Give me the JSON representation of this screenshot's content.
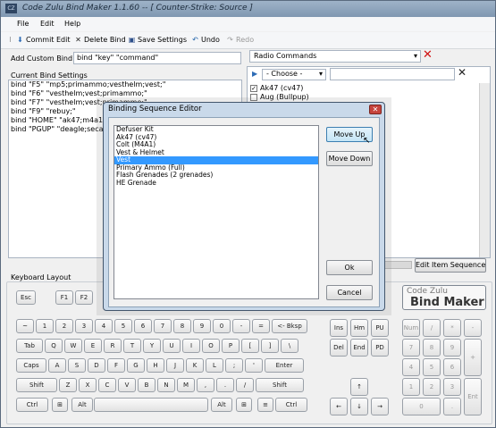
{
  "app": {
    "title": "Code Zulu Bind Maker 1.1.60 -- [ Counter-Strike: Source ]",
    "icon": "app-icon"
  },
  "menu": [
    "File",
    "Edit",
    "Help"
  ],
  "toolbar": {
    "commit": "Commit Edit",
    "delete": "Delete Bind",
    "save": "Save Settings",
    "undo": "Undo",
    "redo": "Redo"
  },
  "custom_bind": {
    "label": "Add Custom Bind:",
    "value": "bind \"key\" \"command\""
  },
  "current_binds": {
    "label": "Current Bind Settings",
    "lines": [
      "bind \"F5\" \"mp5;primammo;vesthelm;vest;\"",
      "bind \"F6\" \"vesthelm;vest;primammo;\"",
      "bind \"F7\" \"vesthelm;vest;primammo;\"",
      "bind \"F9\" \"rebuy;\"",
      "bind \"HOME\" \"ak47;m4a1;prim",
      "bind \"PGUP\" \"deagle;secamm"
    ]
  },
  "right_panel": {
    "commands_select": "Radio Commands",
    "choose_select": "- Choose -",
    "items": [
      {
        "label": "Ak47 (cv47)",
        "checked": true
      },
      {
        "label": "Aug (Bullpup)",
        "checked": false
      }
    ],
    "edit_sequence": "Edit Item Sequence"
  },
  "dialog": {
    "title": "Binding Sequence Editor",
    "items": [
      "Defuser Kit",
      "Ak47 (cv47)",
      "Colt (M4A1)",
      "Vest & Helmet",
      "Vest",
      "Primary Ammo (Full)",
      "Flash Grenades (2 grenades)",
      "HE Grenade"
    ],
    "selected_index": 4,
    "move_up": "Move Up",
    "move_down": "Move Down",
    "ok": "Ok",
    "cancel": "Cancel"
  },
  "keyboard": {
    "label": "Keyboard Layout",
    "logo_top": "Code Zulu",
    "logo_bottom": "Bind Maker",
    "fkeys": [
      "Esc",
      "F1",
      "F2"
    ],
    "row1": [
      "~",
      "1",
      "2",
      "3",
      "4",
      "5",
      "6",
      "7",
      "8",
      "9",
      "0",
      "-",
      "=",
      "<- Bksp"
    ],
    "row2": [
      "Tab",
      "Q",
      "W",
      "E",
      "R",
      "T",
      "Y",
      "U",
      "I",
      "O",
      "P",
      "[",
      "]",
      "\\"
    ],
    "row3": [
      "Caps",
      "A",
      "S",
      "D",
      "F",
      "G",
      "H",
      "J",
      "K",
      "L",
      ";",
      "'",
      "Enter"
    ],
    "row4": [
      "Shift",
      "Z",
      "X",
      "C",
      "V",
      "B",
      "N",
      "M",
      ",",
      ".",
      "/",
      "Shift"
    ],
    "row5": [
      "Ctrl",
      "Alt",
      "Alt",
      "Ctrl"
    ],
    "nav1": [
      "Ins",
      "Hm",
      "PU"
    ],
    "nav2": [
      "Del",
      "End",
      "PD"
    ],
    "arrows": [
      "↑",
      "←",
      "↓",
      "→"
    ],
    "num": [
      "Num",
      "/",
      "*",
      "-",
      "7",
      "8",
      "9",
      "+",
      "4",
      "5",
      "6",
      "1",
      "2",
      "3",
      "Ent",
      "0",
      "."
    ]
  }
}
